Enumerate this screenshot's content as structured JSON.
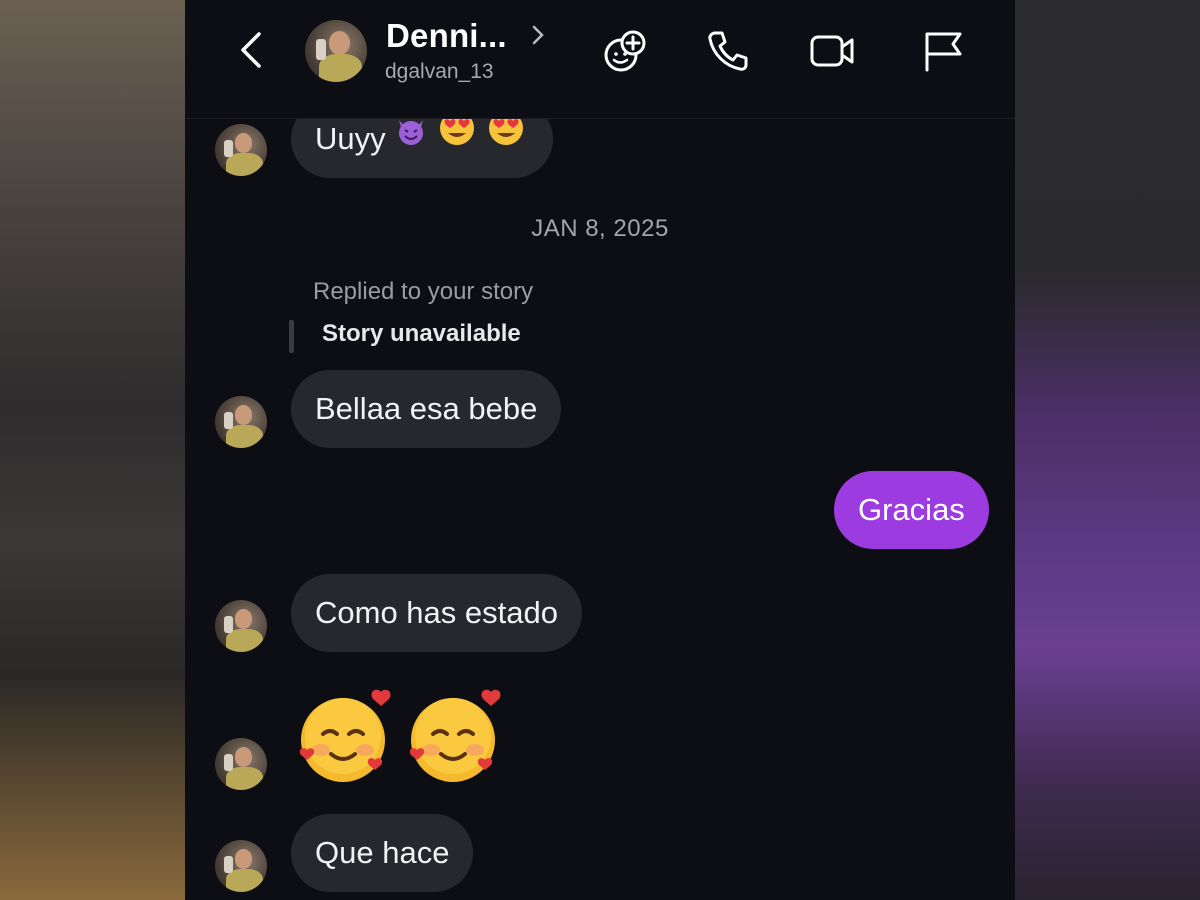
{
  "header": {
    "contact_name": "Denni...",
    "username": "dgalvan_13",
    "icons": [
      "back-icon",
      "chevron-right-icon",
      "effects-icon",
      "phone-icon",
      "video-icon",
      "flag-icon"
    ]
  },
  "conversation": {
    "date_separator": "JAN 8, 2025",
    "story_reply": {
      "label": "Replied to your story",
      "story_status": "Story unavailable"
    },
    "messages": [
      {
        "from": "contact",
        "text": "Uuyy",
        "emoji": [
          "smiling-face-with-horns",
          "smiling-face-with-heart-eyes",
          "smiling-face-with-heart-eyes"
        ]
      },
      {
        "from": "contact",
        "text": "Bellaa esa bebe"
      },
      {
        "from": "me",
        "text": "Gracias"
      },
      {
        "from": "contact",
        "text": "Como has estado"
      },
      {
        "from": "contact",
        "text": "",
        "emoji": [
          "smiling-face-with-hearts",
          "smiling-face-with-hearts"
        ]
      },
      {
        "from": "contact",
        "text": "Que hace"
      }
    ]
  },
  "colors": {
    "background": "#0c0e14",
    "received_bubble": "#26282e",
    "sent_bubble": "#9b3be0",
    "text": "#ffffff",
    "muted_text": "#a3a5ab"
  }
}
